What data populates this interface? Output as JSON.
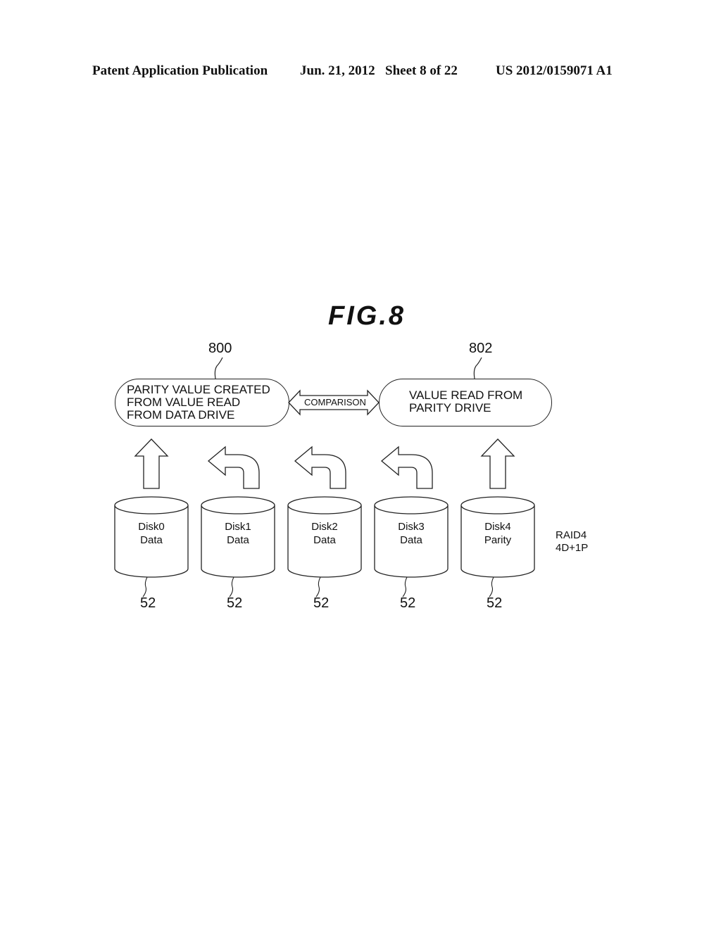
{
  "header": {
    "publication": "Patent Application Publication",
    "date": "Jun. 21, 2012",
    "sheet": "Sheet 8 of 22",
    "patent_number": "US 2012/0159071 A1"
  },
  "figure": {
    "title": "FIG.8",
    "box_left": {
      "ref": "800",
      "lines": [
        "PARITY VALUE CREATED",
        "FROM VALUE READ",
        "FROM DATA DRIVE"
      ]
    },
    "box_right": {
      "ref": "802",
      "lines": [
        "VALUE READ FROM",
        "PARITY DRIVE"
      ]
    },
    "comparison_label": "COMPARISON",
    "disks": [
      {
        "name": "Disk0",
        "role": "Data",
        "ref": "52",
        "arrow": "up"
      },
      {
        "name": "Disk1",
        "role": "Data",
        "ref": "52",
        "arrow": "curved-left"
      },
      {
        "name": "Disk2",
        "role": "Data",
        "ref": "52",
        "arrow": "curved-left"
      },
      {
        "name": "Disk3",
        "role": "Data",
        "ref": "52",
        "arrow": "curved-left"
      },
      {
        "name": "Disk4",
        "role": "Parity",
        "ref": "52",
        "arrow": "up"
      }
    ],
    "raid_label": [
      "RAID4",
      "4D+1P"
    ]
  }
}
